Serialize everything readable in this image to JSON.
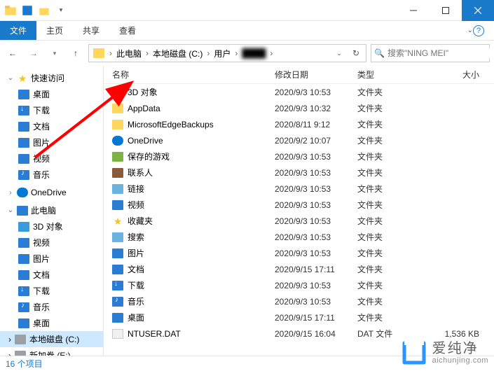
{
  "titlebar": {
    "title": ""
  },
  "ribbon": {
    "file": "文件",
    "tabs": [
      "主页",
      "共享",
      "查看"
    ]
  },
  "nav": {
    "crumbs": [
      "此电脑",
      "本地磁盘 (C:)",
      "用户",
      "████"
    ]
  },
  "search": {
    "placeholder": "搜索\"NING MEI\""
  },
  "sidebar": {
    "quick": {
      "label": "快速访问",
      "items": [
        "桌面",
        "下载",
        "文档",
        "图片",
        "视频",
        "音乐"
      ]
    },
    "onedrive": {
      "label": "OneDrive"
    },
    "pc": {
      "label": "此电脑",
      "items": [
        "3D 对象",
        "视频",
        "图片",
        "文档",
        "下载",
        "音乐",
        "桌面",
        "本地磁盘 (C:)",
        "新加卷 (E:)"
      ]
    }
  },
  "columns": {
    "name": "名称",
    "date": "修改日期",
    "type": "类型",
    "size": "大小"
  },
  "rows": [
    {
      "icon": "3d",
      "name": "3D 对象",
      "date": "2020/9/3 10:53",
      "type": "文件夹",
      "size": ""
    },
    {
      "icon": "folder",
      "name": "AppData",
      "date": "2020/9/3 10:32",
      "type": "文件夹",
      "size": ""
    },
    {
      "icon": "folder",
      "name": "MicrosoftEdgeBackups",
      "date": "2020/8/11 9:12",
      "type": "文件夹",
      "size": ""
    },
    {
      "icon": "onedrive",
      "name": "OneDrive",
      "date": "2020/9/2 10:07",
      "type": "文件夹",
      "size": ""
    },
    {
      "icon": "game",
      "name": "保存的游戏",
      "date": "2020/9/3 10:53",
      "type": "文件夹",
      "size": ""
    },
    {
      "icon": "contact",
      "name": "联系人",
      "date": "2020/9/3 10:53",
      "type": "文件夹",
      "size": ""
    },
    {
      "icon": "link",
      "name": "链接",
      "date": "2020/9/3 10:53",
      "type": "文件夹",
      "size": ""
    },
    {
      "icon": "video",
      "name": "视频",
      "date": "2020/9/3 10:53",
      "type": "文件夹",
      "size": ""
    },
    {
      "icon": "star",
      "name": "收藏夹",
      "date": "2020/9/3 10:53",
      "type": "文件夹",
      "size": ""
    },
    {
      "icon": "search",
      "name": "搜索",
      "date": "2020/9/3 10:53",
      "type": "文件夹",
      "size": ""
    },
    {
      "icon": "pic",
      "name": "图片",
      "date": "2020/9/3 10:53",
      "type": "文件夹",
      "size": ""
    },
    {
      "icon": "doc",
      "name": "文档",
      "date": "2020/9/15 17:11",
      "type": "文件夹",
      "size": ""
    },
    {
      "icon": "download",
      "name": "下载",
      "date": "2020/9/3 10:53",
      "type": "文件夹",
      "size": ""
    },
    {
      "icon": "music",
      "name": "音乐",
      "date": "2020/9/3 10:53",
      "type": "文件夹",
      "size": ""
    },
    {
      "icon": "desktop",
      "name": "桌面",
      "date": "2020/9/15 17:11",
      "type": "文件夹",
      "size": ""
    },
    {
      "icon": "dat",
      "name": "NTUSER.DAT",
      "date": "2020/9/15 16:04",
      "type": "DAT 文件",
      "size": "1,536 KB"
    }
  ],
  "status": {
    "count": "16 个项目"
  },
  "watermark": {
    "zh": "爱纯净",
    "en": "aichunjing.com"
  }
}
